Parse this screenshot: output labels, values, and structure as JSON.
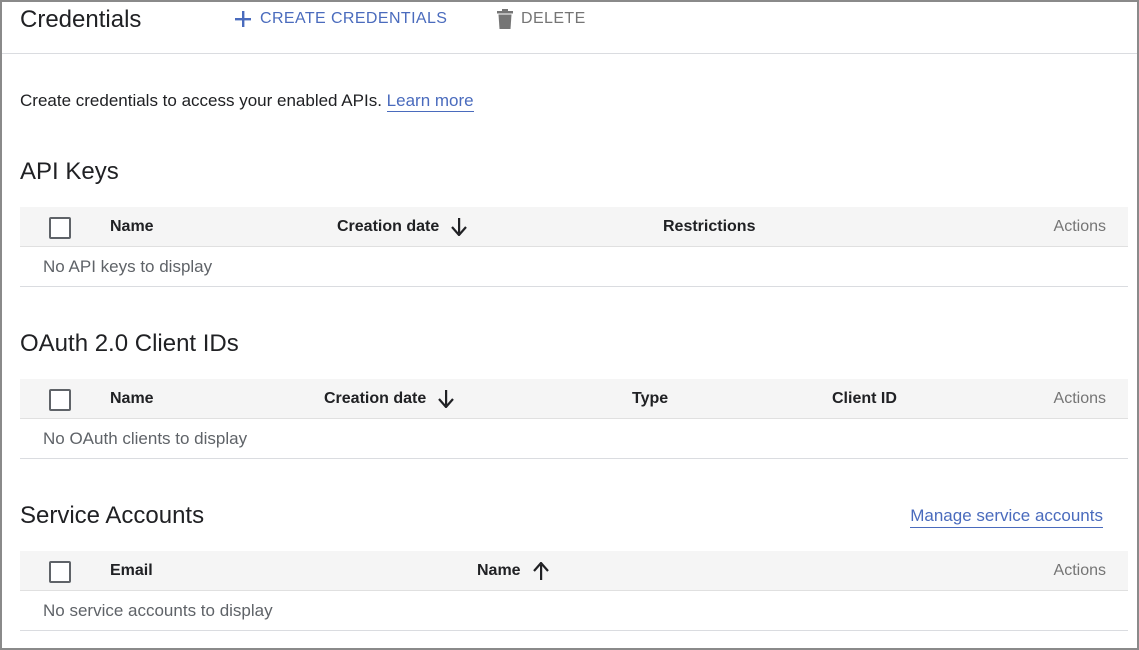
{
  "header": {
    "title": "Credentials",
    "create_label": "CREATE CREDENTIALS",
    "delete_label": "DELETE"
  },
  "intro": {
    "text": "Create credentials to access your enabled APIs.",
    "link": "Learn more"
  },
  "api_keys": {
    "title": "API Keys",
    "columns": [
      "Name",
      "Creation date",
      "Restrictions",
      "Actions"
    ],
    "empty": "No API keys to display"
  },
  "oauth": {
    "title": "OAuth 2.0 Client IDs",
    "columns": [
      "Name",
      "Creation date",
      "Type",
      "Client ID",
      "Actions"
    ],
    "empty": "No OAuth clients to display"
  },
  "service_accounts": {
    "title": "Service Accounts",
    "manage_link": "Manage service accounts",
    "columns": [
      "Email",
      "Name",
      "Actions"
    ],
    "empty": "No service accounts to display"
  },
  "icons": {
    "create": "plus-icon",
    "delete": "trash-icon",
    "sort_desc": "arrow-down-icon",
    "sort_asc": "arrow-up-icon"
  },
  "colors": {
    "accent": "#4a6bbd",
    "muted": "#757575",
    "header_bg": "#f5f5f5"
  }
}
